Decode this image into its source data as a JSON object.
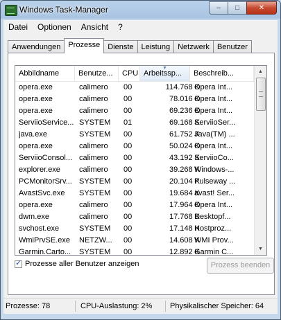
{
  "window": {
    "title": "Windows Task-Manager"
  },
  "caption": {
    "minimize": "–",
    "maximize": "□",
    "close": "✕"
  },
  "menu": [
    "Datei",
    "Optionen",
    "Ansicht",
    "?"
  ],
  "tabs": [
    "Anwendungen",
    "Prozesse",
    "Dienste",
    "Leistung",
    "Netzwerk",
    "Benutzer"
  ],
  "active_tab": "Prozesse",
  "columns": {
    "name": "Abbildname",
    "user": "Benutze...",
    "cpu": "CPU",
    "mem": "Arbeitssp...",
    "desc": "Beschreib..."
  },
  "processes": [
    {
      "name": "opera.exe",
      "user": "calimero",
      "cpu": "00",
      "mem": "114.768 K",
      "desc": "Opera Int..."
    },
    {
      "name": "opera.exe",
      "user": "calimero",
      "cpu": "00",
      "mem": "78.016 K",
      "desc": "Opera Int..."
    },
    {
      "name": "opera.exe",
      "user": "calimero",
      "cpu": "00",
      "mem": "69.236 K",
      "desc": "Opera Int..."
    },
    {
      "name": "ServiioService...",
      "user": "SYSTEM",
      "cpu": "01",
      "mem": "69.168 K",
      "desc": "ServiioSer..."
    },
    {
      "name": "java.exe",
      "user": "SYSTEM",
      "cpu": "00",
      "mem": "61.752 K",
      "desc": "Java(TM) ..."
    },
    {
      "name": "opera.exe",
      "user": "calimero",
      "cpu": "00",
      "mem": "50.024 K",
      "desc": "Opera Int..."
    },
    {
      "name": "ServiioConsol...",
      "user": "calimero",
      "cpu": "00",
      "mem": "43.192 K",
      "desc": "ServiioCo..."
    },
    {
      "name": "explorer.exe",
      "user": "calimero",
      "cpu": "00",
      "mem": "39.268 K",
      "desc": "Windows-..."
    },
    {
      "name": "PCMonitorSrv...",
      "user": "SYSTEM",
      "cpu": "00",
      "mem": "20.104 K",
      "desc": "Pulseway ..."
    },
    {
      "name": "AvastSvc.exe",
      "user": "SYSTEM",
      "cpu": "00",
      "mem": "19.684 K",
      "desc": "avast! Ser..."
    },
    {
      "name": "opera.exe",
      "user": "calimero",
      "cpu": "00",
      "mem": "17.964 K",
      "desc": "Opera Int..."
    },
    {
      "name": "dwm.exe",
      "user": "calimero",
      "cpu": "00",
      "mem": "17.768 K",
      "desc": "Desktopf..."
    },
    {
      "name": "svchost.exe",
      "user": "SYSTEM",
      "cpu": "00",
      "mem": "17.148 K",
      "desc": "Hostproz..."
    },
    {
      "name": "WmiPrvSE.exe",
      "user": "NETZW...",
      "cpu": "00",
      "mem": "14.608 K",
      "desc": "WMI Prov..."
    },
    {
      "name": "Garmin.Carto...",
      "user": "SYSTEM",
      "cpu": "00",
      "mem": "12.892 K",
      "desc": "Garmin C..."
    }
  ],
  "show_all_users": {
    "label": "Prozesse aller Benutzer anzeigen",
    "checked": true
  },
  "end_process": {
    "label": "Prozess beenden",
    "enabled": false
  },
  "status": {
    "processes": "Prozesse: 78",
    "cpu": "CPU-Auslastung: 2%",
    "memory": "Physikalischer Speicher: 64"
  }
}
